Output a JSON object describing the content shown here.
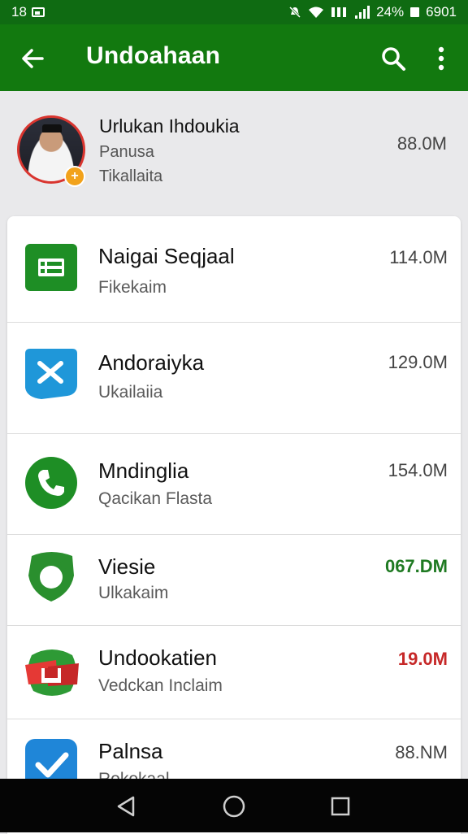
{
  "status_bar": {
    "left_text": "18",
    "battery_text": "24%",
    "time_text": "6901",
    "icons": [
      "image-icon",
      "mute-icon",
      "wifi-icon",
      "data-icon",
      "signal-icon",
      "battery-icon"
    ]
  },
  "app_bar": {
    "title": "Undoahaan",
    "icons": [
      "back-arrow-icon",
      "search-icon",
      "more-vert-icon"
    ]
  },
  "profile": {
    "name": "Urlukan Ihdoukia",
    "line1": "Panusa",
    "line2": "Tikallaita",
    "size": "88.0M",
    "badge": "+"
  },
  "apps": [
    {
      "name": "Naigai Seqjaal",
      "sub": "Fikekaim",
      "size": "114.0M",
      "size_color": "#444444",
      "icon": "sheets-icon"
    },
    {
      "name": "Andoraiyka",
      "sub": "Ukailaiia",
      "size": "129.0M",
      "size_color": "#444444",
      "icon": "blue-x-app-icon"
    },
    {
      "name": "Mndinglia",
      "sub": "Qacikan Flasta",
      "size": "154.0M",
      "size_color": "#444444",
      "icon": "phone-icon"
    },
    {
      "name": "Viesie",
      "sub": "Ulkakaim",
      "size": "067.DM",
      "size_color": "#1f7a22",
      "icon": "green-shield-icon"
    },
    {
      "name": "Undookatien",
      "sub": "Vedckan Inclaim",
      "size": "19.0M",
      "size_color": "#c62828",
      "icon": "red-green-app-icon"
    },
    {
      "name": "Palnsa",
      "sub": "Rokokaal",
      "size": "88.NM",
      "size_color": "#444444",
      "icon": "blue-check-icon"
    }
  ],
  "colors": {
    "status_bar": "#0f6b12",
    "app_bar": "#12790f",
    "background": "#e9e9eb",
    "nav_bar": "#050505"
  },
  "nav": [
    "back-triangle-icon",
    "home-circle-icon",
    "recents-square-icon"
  ]
}
